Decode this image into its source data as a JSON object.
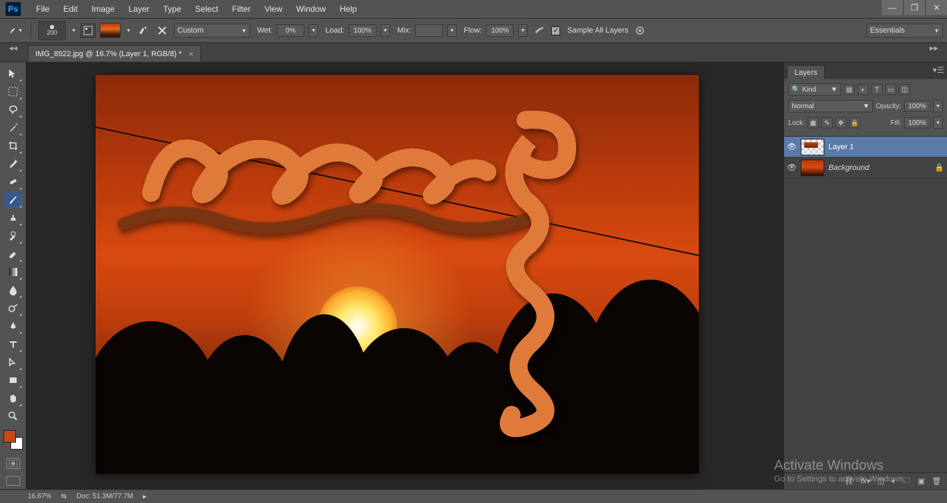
{
  "app": {
    "logo": "Ps"
  },
  "menu": [
    "File",
    "Edit",
    "Image",
    "Layer",
    "Type",
    "Select",
    "Filter",
    "View",
    "Window",
    "Help"
  ],
  "window_controls": {
    "min": "—",
    "max": "❐",
    "close": "✕"
  },
  "options": {
    "brush_size": "200",
    "preset": "Custom",
    "wet_label": "Wet:",
    "wet_val": "0%",
    "load_label": "Load:",
    "load_val": "100%",
    "mix_label": "Mix:",
    "mix_val": "",
    "flow_label": "Flow:",
    "flow_val": "100%",
    "sample_all": "Sample All Layers",
    "workspace": "Essentials"
  },
  "tab": {
    "title": "IMG_8922.jpg @ 16.7% (Layer 1, RGB/8) *"
  },
  "layers_panel": {
    "tab": "Layers",
    "filter_kind": "Kind",
    "blend_mode": "Normal",
    "opacity_label": "Opacity:",
    "opacity_val": "100%",
    "lock_label": "Lock:",
    "fill_label": "Fill:",
    "fill_val": "100%",
    "layers": [
      {
        "name": "Layer 1",
        "selected": true,
        "locked": false,
        "thumb": "trans"
      },
      {
        "name": "Background",
        "selected": false,
        "locked": true,
        "thumb": "bg",
        "italic": true
      }
    ]
  },
  "status": {
    "zoom": "16.67%",
    "doc": "Doc: 51.3M/77.7M"
  },
  "watermark": {
    "line1": "Activate Windows",
    "line2": "Go to Settings to activate Windows."
  }
}
